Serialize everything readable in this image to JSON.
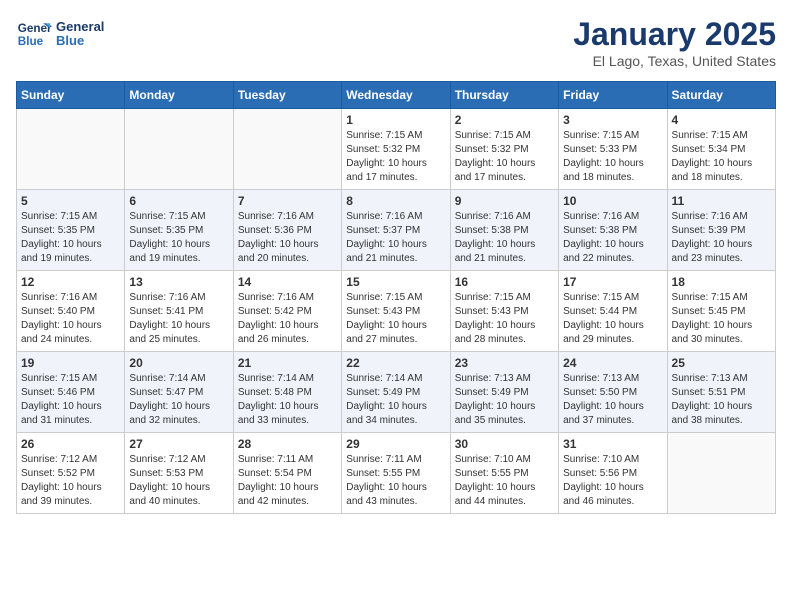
{
  "logo": {
    "line1": "General",
    "line2": "Blue"
  },
  "header": {
    "title": "January 2025",
    "location": "El Lago, Texas, United States"
  },
  "weekdays": [
    "Sunday",
    "Monday",
    "Tuesday",
    "Wednesday",
    "Thursday",
    "Friday",
    "Saturday"
  ],
  "weeks": [
    [
      {
        "day": "",
        "sunrise": "",
        "sunset": "",
        "daylight": ""
      },
      {
        "day": "",
        "sunrise": "",
        "sunset": "",
        "daylight": ""
      },
      {
        "day": "",
        "sunrise": "",
        "sunset": "",
        "daylight": ""
      },
      {
        "day": "1",
        "sunrise": "Sunrise: 7:15 AM",
        "sunset": "Sunset: 5:32 PM",
        "daylight": "Daylight: 10 hours and 17 minutes."
      },
      {
        "day": "2",
        "sunrise": "Sunrise: 7:15 AM",
        "sunset": "Sunset: 5:32 PM",
        "daylight": "Daylight: 10 hours and 17 minutes."
      },
      {
        "day": "3",
        "sunrise": "Sunrise: 7:15 AM",
        "sunset": "Sunset: 5:33 PM",
        "daylight": "Daylight: 10 hours and 18 minutes."
      },
      {
        "day": "4",
        "sunrise": "Sunrise: 7:15 AM",
        "sunset": "Sunset: 5:34 PM",
        "daylight": "Daylight: 10 hours and 18 minutes."
      }
    ],
    [
      {
        "day": "5",
        "sunrise": "Sunrise: 7:15 AM",
        "sunset": "Sunset: 5:35 PM",
        "daylight": "Daylight: 10 hours and 19 minutes."
      },
      {
        "day": "6",
        "sunrise": "Sunrise: 7:15 AM",
        "sunset": "Sunset: 5:35 PM",
        "daylight": "Daylight: 10 hours and 19 minutes."
      },
      {
        "day": "7",
        "sunrise": "Sunrise: 7:16 AM",
        "sunset": "Sunset: 5:36 PM",
        "daylight": "Daylight: 10 hours and 20 minutes."
      },
      {
        "day": "8",
        "sunrise": "Sunrise: 7:16 AM",
        "sunset": "Sunset: 5:37 PM",
        "daylight": "Daylight: 10 hours and 21 minutes."
      },
      {
        "day": "9",
        "sunrise": "Sunrise: 7:16 AM",
        "sunset": "Sunset: 5:38 PM",
        "daylight": "Daylight: 10 hours and 21 minutes."
      },
      {
        "day": "10",
        "sunrise": "Sunrise: 7:16 AM",
        "sunset": "Sunset: 5:38 PM",
        "daylight": "Daylight: 10 hours and 22 minutes."
      },
      {
        "day": "11",
        "sunrise": "Sunrise: 7:16 AM",
        "sunset": "Sunset: 5:39 PM",
        "daylight": "Daylight: 10 hours and 23 minutes."
      }
    ],
    [
      {
        "day": "12",
        "sunrise": "Sunrise: 7:16 AM",
        "sunset": "Sunset: 5:40 PM",
        "daylight": "Daylight: 10 hours and 24 minutes."
      },
      {
        "day": "13",
        "sunrise": "Sunrise: 7:16 AM",
        "sunset": "Sunset: 5:41 PM",
        "daylight": "Daylight: 10 hours and 25 minutes."
      },
      {
        "day": "14",
        "sunrise": "Sunrise: 7:16 AM",
        "sunset": "Sunset: 5:42 PM",
        "daylight": "Daylight: 10 hours and 26 minutes."
      },
      {
        "day": "15",
        "sunrise": "Sunrise: 7:15 AM",
        "sunset": "Sunset: 5:43 PM",
        "daylight": "Daylight: 10 hours and 27 minutes."
      },
      {
        "day": "16",
        "sunrise": "Sunrise: 7:15 AM",
        "sunset": "Sunset: 5:43 PM",
        "daylight": "Daylight: 10 hours and 28 minutes."
      },
      {
        "day": "17",
        "sunrise": "Sunrise: 7:15 AM",
        "sunset": "Sunset: 5:44 PM",
        "daylight": "Daylight: 10 hours and 29 minutes."
      },
      {
        "day": "18",
        "sunrise": "Sunrise: 7:15 AM",
        "sunset": "Sunset: 5:45 PM",
        "daylight": "Daylight: 10 hours and 30 minutes."
      }
    ],
    [
      {
        "day": "19",
        "sunrise": "Sunrise: 7:15 AM",
        "sunset": "Sunset: 5:46 PM",
        "daylight": "Daylight: 10 hours and 31 minutes."
      },
      {
        "day": "20",
        "sunrise": "Sunrise: 7:14 AM",
        "sunset": "Sunset: 5:47 PM",
        "daylight": "Daylight: 10 hours and 32 minutes."
      },
      {
        "day": "21",
        "sunrise": "Sunrise: 7:14 AM",
        "sunset": "Sunset: 5:48 PM",
        "daylight": "Daylight: 10 hours and 33 minutes."
      },
      {
        "day": "22",
        "sunrise": "Sunrise: 7:14 AM",
        "sunset": "Sunset: 5:49 PM",
        "daylight": "Daylight: 10 hours and 34 minutes."
      },
      {
        "day": "23",
        "sunrise": "Sunrise: 7:13 AM",
        "sunset": "Sunset: 5:49 PM",
        "daylight": "Daylight: 10 hours and 35 minutes."
      },
      {
        "day": "24",
        "sunrise": "Sunrise: 7:13 AM",
        "sunset": "Sunset: 5:50 PM",
        "daylight": "Daylight: 10 hours and 37 minutes."
      },
      {
        "day": "25",
        "sunrise": "Sunrise: 7:13 AM",
        "sunset": "Sunset: 5:51 PM",
        "daylight": "Daylight: 10 hours and 38 minutes."
      }
    ],
    [
      {
        "day": "26",
        "sunrise": "Sunrise: 7:12 AM",
        "sunset": "Sunset: 5:52 PM",
        "daylight": "Daylight: 10 hours and 39 minutes."
      },
      {
        "day": "27",
        "sunrise": "Sunrise: 7:12 AM",
        "sunset": "Sunset: 5:53 PM",
        "daylight": "Daylight: 10 hours and 40 minutes."
      },
      {
        "day": "28",
        "sunrise": "Sunrise: 7:11 AM",
        "sunset": "Sunset: 5:54 PM",
        "daylight": "Daylight: 10 hours and 42 minutes."
      },
      {
        "day": "29",
        "sunrise": "Sunrise: 7:11 AM",
        "sunset": "Sunset: 5:55 PM",
        "daylight": "Daylight: 10 hours and 43 minutes."
      },
      {
        "day": "30",
        "sunrise": "Sunrise: 7:10 AM",
        "sunset": "Sunset: 5:55 PM",
        "daylight": "Daylight: 10 hours and 44 minutes."
      },
      {
        "day": "31",
        "sunrise": "Sunrise: 7:10 AM",
        "sunset": "Sunset: 5:56 PM",
        "daylight": "Daylight: 10 hours and 46 minutes."
      },
      {
        "day": "",
        "sunrise": "",
        "sunset": "",
        "daylight": ""
      }
    ]
  ]
}
